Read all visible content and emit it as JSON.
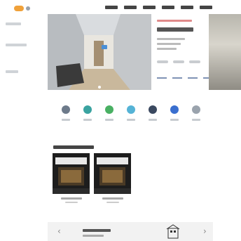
{
  "nav": {
    "logo_text": "",
    "menu": [
      {
        "label": ""
      },
      {
        "label": ""
      },
      {
        "label": ""
      },
      {
        "label": ""
      },
      {
        "label": ""
      },
      {
        "label": ""
      }
    ]
  },
  "hero": {
    "slide_label": "",
    "card": {
      "tag": "",
      "title": "",
      "rows": [
        "",
        "",
        ""
      ],
      "chips": [
        "",
        "",
        ""
      ],
      "stats": [
        "",
        "",
        "",
        ""
      ]
    }
  },
  "categories": [
    {
      "label": "",
      "icon": "home-icon",
      "color": "#6d7a8a"
    },
    {
      "label": "",
      "icon": "ship-icon",
      "color": "#3aa3a0"
    },
    {
      "label": "",
      "icon": "plant-icon",
      "color": "#49b063"
    },
    {
      "label": "",
      "icon": "water-icon",
      "color": "#55b3d6"
    },
    {
      "label": "",
      "icon": "bus-icon",
      "color": "#3b4960"
    },
    {
      "label": "",
      "icon": "person-icon",
      "color": "#3a6fcf"
    },
    {
      "label": "",
      "icon": "more-icon",
      "color": "#9aa3ad"
    }
  ],
  "section": {
    "title": "",
    "items": [
      {
        "caption": "",
        "sub": ""
      },
      {
        "caption": "",
        "sub": ""
      }
    ]
  },
  "banner": {
    "title": "",
    "subtitle": "",
    "icon": "building-icon"
  },
  "colors": {
    "accent": "#f0a13a",
    "card_stat": "#7f92b5",
    "banner_bg": "#f2f2f2"
  }
}
